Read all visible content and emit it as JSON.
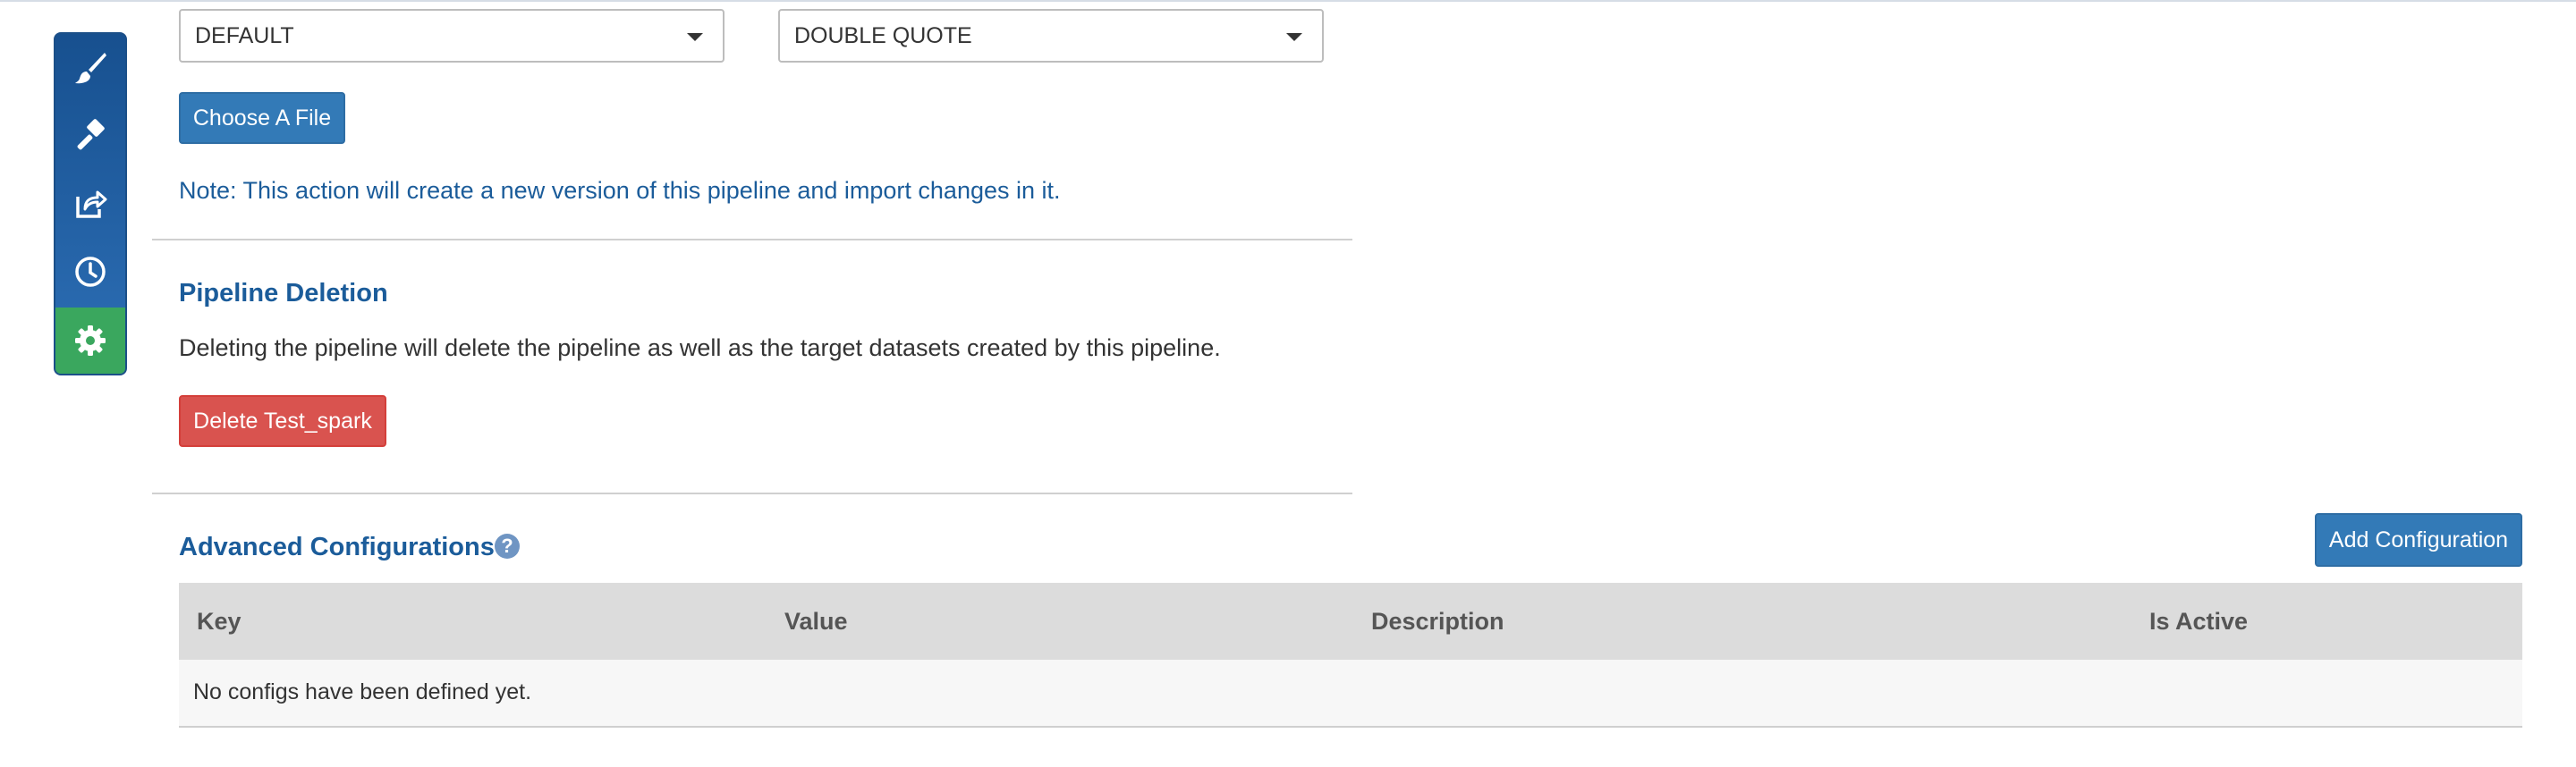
{
  "sidebar": {
    "items": [
      {
        "icon": "paintbrush-icon",
        "active": false
      },
      {
        "icon": "hammer-icon",
        "active": false
      },
      {
        "icon": "share-icon",
        "active": false
      },
      {
        "icon": "clock-icon",
        "active": false
      },
      {
        "icon": "gear-icon",
        "active": true
      }
    ]
  },
  "import": {
    "select_left": "DEFAULT",
    "select_right": "DOUBLE QUOTE",
    "choose_file_label": "Choose A File",
    "note": "Note: This action will create a new version of this pipeline and import changes in it."
  },
  "deletion": {
    "title": "Pipeline Deletion",
    "description": "Deleting the pipeline will delete the pipeline as well as the target datasets created by this pipeline.",
    "delete_label": "Delete Test_spark"
  },
  "advanced": {
    "title": "Advanced Configurations",
    "help_glyph": "?",
    "add_label": "Add Configuration",
    "columns": [
      "Key",
      "Value",
      "Description",
      "Is Active"
    ],
    "empty_message": "No configs have been defined yet."
  },
  "colors": {
    "primary": "#337ab7",
    "danger": "#d9534f",
    "active_nav": "#3aa75e",
    "heading": "#1b5c9a"
  }
}
